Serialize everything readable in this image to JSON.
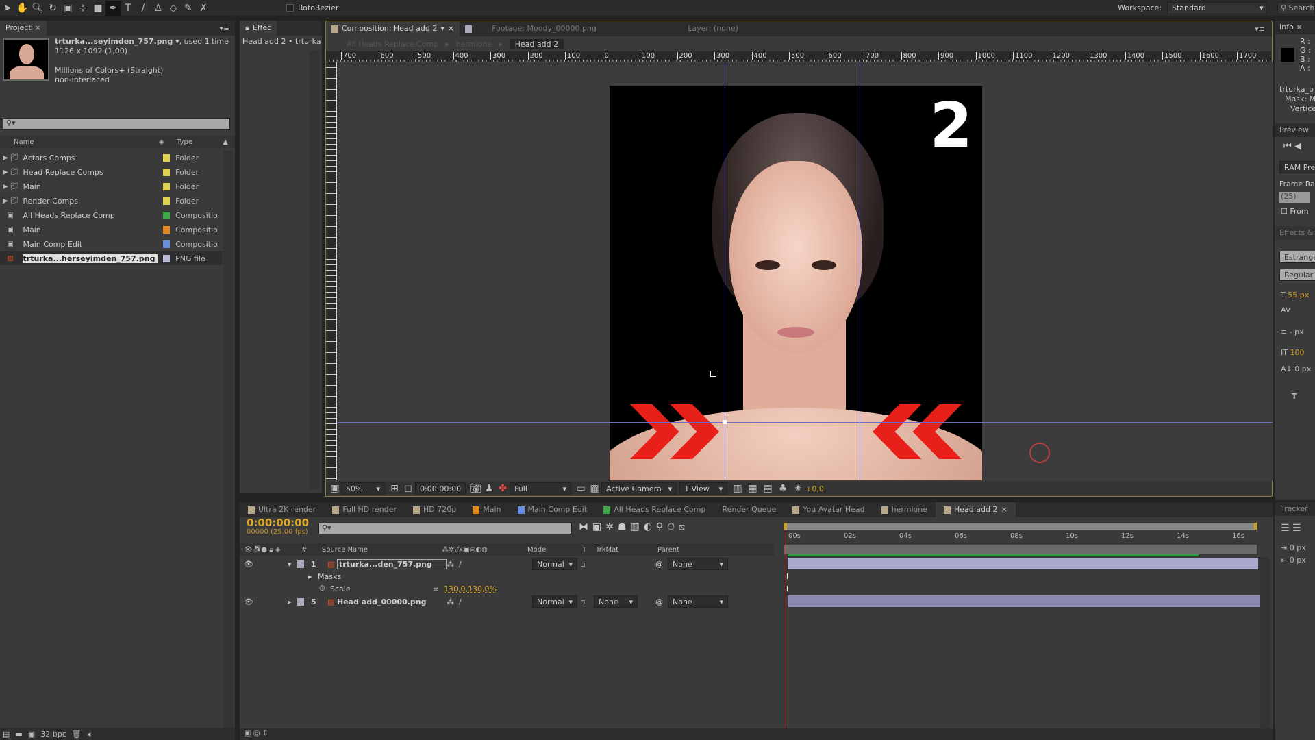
{
  "toolbar": {
    "rotobezier": "RotoBezier",
    "workspace_label": "Workspace:",
    "workspace_value": "Standard",
    "search_placeholder": "Search"
  },
  "project": {
    "tab": "Project",
    "file_name": "trturka...seyimden_757.png ▾",
    "used": ", used 1 time",
    "dimensions": "1126 x 1092 (1,00)",
    "colors": "Millions of Colors+ (Straight)",
    "interlace": "non-interlaced",
    "col_name": "Name",
    "col_type": "Type",
    "items": [
      {
        "name": "Actors Comps",
        "type": "Folder",
        "kind": "folder",
        "color": "#e0d050"
      },
      {
        "name": "Head Replace Comps",
        "type": "Folder",
        "kind": "folder",
        "color": "#e0d050"
      },
      {
        "name": "Main",
        "type": "Folder",
        "kind": "folder",
        "color": "#e0d050"
      },
      {
        "name": "Render Comps",
        "type": "Folder",
        "kind": "folder",
        "color": "#e0d050"
      },
      {
        "name": "All Heads Replace Comp",
        "type": "Compositio",
        "kind": "comp",
        "color": "#3ea84a"
      },
      {
        "name": "Main",
        "type": "Compositio",
        "kind": "comp",
        "color": "#e08a1e"
      },
      {
        "name": "Main Comp Edit",
        "type": "Compositio",
        "kind": "comp",
        "color": "#6a8ee0"
      },
      {
        "name": "trturka...herseyimden_757.png",
        "type": "PNG file",
        "kind": "png",
        "color": "#b8b8d8",
        "selected": true
      }
    ],
    "bpc": "32 bpc"
  },
  "effects": {
    "tab": "Effec",
    "breadcrumb": "Head add 2 • trturka"
  },
  "comp": {
    "tab": "Composition: Head add 2",
    "footage_tab": "Footage: Moody_00000.png",
    "layer_tab": "Layer: (none)",
    "breadcrumbs": [
      "All Heads Replace Comp",
      "hermione",
      "Head add 2"
    ],
    "ruler_labels": [
      "700",
      "600",
      "500",
      "400",
      "300",
      "200",
      "100",
      "0",
      "100",
      "200",
      "300",
      "400",
      "500",
      "600",
      "700",
      "800",
      "900",
      "1000",
      "1100",
      "1200",
      "1300",
      "1400",
      "1500",
      "1600",
      "1700"
    ],
    "overlay_number": "2",
    "zoom": "50%",
    "timecode": "0:00:00:00",
    "resolution": "Full",
    "camera": "Active Camera",
    "views": "1 View",
    "exposure": "+0,0"
  },
  "timeline_tabs": [
    {
      "label": "Ultra 2K render",
      "color": "#b7a78a"
    },
    {
      "label": "Full HD render",
      "color": "#b7a78a"
    },
    {
      "label": "HD 720p",
      "color": "#b7a78a"
    },
    {
      "label": "Main",
      "color": "#e08a1e"
    },
    {
      "label": "Main Comp Edit",
      "color": "#6a8ee0"
    },
    {
      "label": "All Heads Replace Comp",
      "color": "#3ea84a"
    },
    {
      "label": "Render Queue",
      "color": ""
    },
    {
      "label": "You Avatar Head",
      "color": "#b7a78a"
    },
    {
      "label": "hermione",
      "color": "#b7a78a"
    },
    {
      "label": "Head add 2",
      "color": "#b7a78a",
      "active": true
    }
  ],
  "timeline": {
    "timecode": "0:00:00:00",
    "fps": "00000 (25.00 fps)",
    "headers": {
      "num": "#",
      "source": "Source Name",
      "mode": "Mode",
      "t": "T",
      "trkmat": "TrkMat",
      "parent": "Parent"
    },
    "time_labels": [
      "00s",
      "02s",
      "04s",
      "06s",
      "08s",
      "10s",
      "12s",
      "14s",
      "16s"
    ],
    "layers": [
      {
        "num": "1",
        "name": "trturka...den_757.png",
        "mode": "Normal",
        "trkmat": "",
        "parent": "None"
      },
      {
        "num": "5",
        "name": "Head add_00000.png",
        "mode": "Normal",
        "trkmat": "None",
        "parent": "None"
      }
    ],
    "masks": "Masks",
    "scale_label": "Scale",
    "scale_value": "130,0,130,0%"
  },
  "right": {
    "info_tab": "Info",
    "r": "R :",
    "g": "G :",
    "b": "B :",
    "a": "A :",
    "layer": "trturka_b",
    "mask": "Mask: M",
    "vertices": "Vertice",
    "preview_tab": "Preview",
    "ram": "RAM Pre",
    "frame_rate": "Frame Ra",
    "fps": "(25)",
    "from": "From",
    "effects_tab": "Effects &",
    "font": "Estrange",
    "style": "Regular",
    "size": "55 px",
    "px1": "- px",
    "leading": "100",
    "baseline": "0 px",
    "tracker_tab": "Tracker",
    "indent1": "0 px",
    "indent2": "0 px"
  }
}
